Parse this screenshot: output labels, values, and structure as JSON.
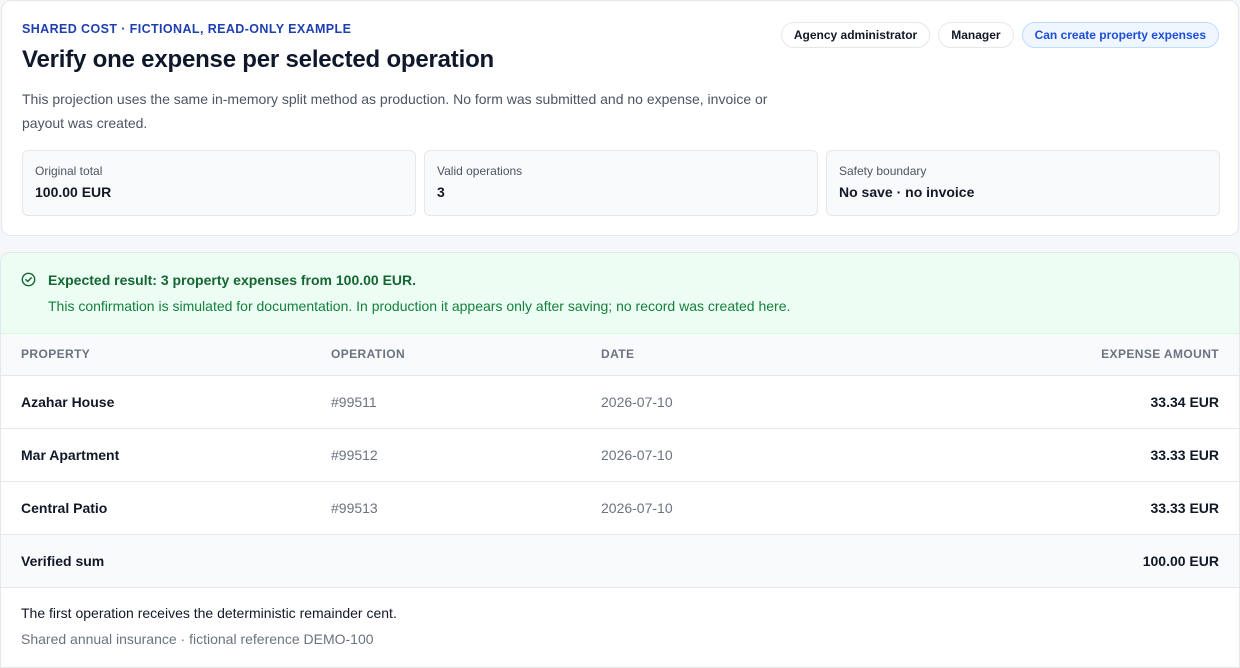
{
  "header": {
    "eyebrow": "SHARED COST · FICTIONAL, READ-ONLY EXAMPLE",
    "title": "Verify one expense per selected operation",
    "description": "This projection uses the same in-memory split method as production. No form was submitted and no expense, invoice or payout was created.",
    "roles": [
      {
        "label": "Agency administrator"
      },
      {
        "label": "Manager"
      },
      {
        "label": "Can create property expenses"
      }
    ],
    "stats": [
      {
        "label": "Original total",
        "value": "100.00 EUR"
      },
      {
        "label": "Valid operations",
        "value": "3"
      },
      {
        "label": "Safety boundary",
        "value": "No save · no invoice"
      }
    ]
  },
  "result": {
    "icon": "check-circle-icon",
    "title": "Expected result: 3 property expenses from 100.00 EUR.",
    "note": "This confirmation is simulated for documentation. In production it appears only after saving; no record was created here."
  },
  "table": {
    "columns": [
      "PROPERTY",
      "OPERATION",
      "DATE",
      "EXPENSE AMOUNT"
    ],
    "rows": [
      {
        "property": "Azahar House",
        "operation": "#99511",
        "date": "2026-07-10",
        "amount": "33.34 EUR"
      },
      {
        "property": "Mar Apartment",
        "operation": "#99512",
        "date": "2026-07-10",
        "amount": "33.33 EUR"
      },
      {
        "property": "Central Patio",
        "operation": "#99513",
        "date": "2026-07-10",
        "amount": "33.33 EUR"
      }
    ],
    "total": {
      "label": "Verified sum",
      "amount": "100.00 EUR"
    }
  },
  "footer": {
    "note": "The first operation receives the deterministic remainder cent.",
    "reference": "Shared annual insurance · fictional reference DEMO-100"
  },
  "colors": {
    "accent": "#1d4ed8",
    "success_bg": "#ecfdf3",
    "success_text": "#166534"
  }
}
